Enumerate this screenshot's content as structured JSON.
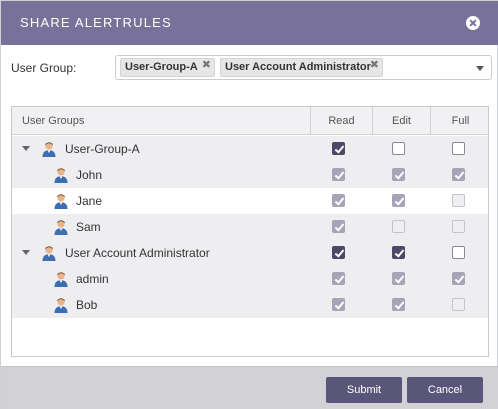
{
  "dialog": {
    "title": "SHARE ALERTRULES",
    "colors": {
      "titlebar": "#78729a",
      "button": "#5a567a",
      "checked": "#4b4868"
    }
  },
  "user_group": {
    "label": "User Group:",
    "chips": [
      {
        "label": "User-Group-A",
        "remove": "✖"
      },
      {
        "label": "User Account Administrator",
        "remove": "✖"
      }
    ]
  },
  "grid": {
    "columns": [
      "User Groups",
      "Read",
      "Edit",
      "Full"
    ],
    "rows": [
      {
        "name": "User-Group-A",
        "kind": "group",
        "read": "on",
        "edit": "off",
        "full": "off"
      },
      {
        "name": "John",
        "kind": "user",
        "read": "on-dim",
        "edit": "on-dim",
        "full": "on-dim"
      },
      {
        "name": "Jane",
        "kind": "user",
        "read": "on-dim",
        "edit": "on-dim",
        "full": "off-dim"
      },
      {
        "name": "Sam",
        "kind": "user",
        "read": "on-dim",
        "edit": "off-dim",
        "full": "off-dim"
      },
      {
        "name": "User Account Administrator",
        "kind": "group",
        "read": "on",
        "edit": "on",
        "full": "off"
      },
      {
        "name": "admin",
        "kind": "user",
        "read": "on-dim",
        "edit": "on-dim",
        "full": "on-dim"
      },
      {
        "name": "Bob",
        "kind": "user",
        "read": "on-dim",
        "edit": "on-dim",
        "full": "off-dim"
      }
    ]
  },
  "footer": {
    "submit": "Submit",
    "cancel": "Cancel"
  }
}
